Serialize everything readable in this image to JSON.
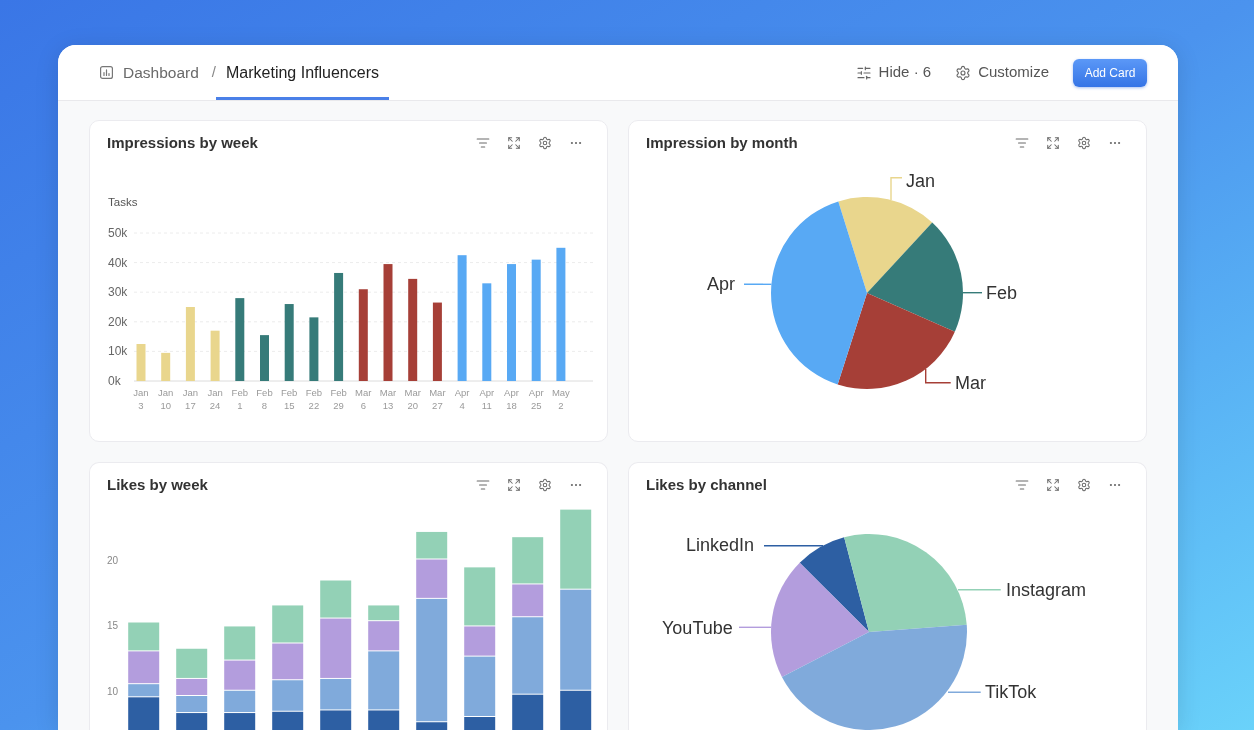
{
  "header": {
    "breadcrumbs": [
      {
        "label": "Dashboard",
        "selected": false
      },
      {
        "label": "Marketing Influencers",
        "selected": true
      }
    ],
    "separator": "/",
    "actions": [
      {
        "kind": "hide",
        "label": "Hide · 6"
      },
      {
        "kind": "customize",
        "label": "Customize"
      }
    ],
    "add_button": "Add Card"
  },
  "cards": [
    {
      "kind": "bar",
      "title": "Impressions by week",
      "chart_data": {
        "type": "bar",
        "ylabel": "Tasks",
        "categories": [
          "Jan 3",
          "Jan 10",
          "Jan 17",
          "Jan 24",
          "Feb 1",
          "Feb 8",
          "Feb 15",
          "Feb 22",
          "Feb 29",
          "Mar 6",
          "Mar 13",
          "Mar 20",
          "Mar 27",
          "Apr 4",
          "Apr 11",
          "Apr 18",
          "Apr 25",
          "May 2"
        ],
        "stacked": true,
        "grid": true,
        "ylim": [
          0,
          50000
        ],
        "yticks": [
          {
            "value": 0,
            "label": "0k"
          },
          {
            "value": 10000,
            "label": "10k"
          },
          {
            "value": 20000,
            "label": "20k"
          },
          {
            "value": 30000,
            "label": "30k"
          },
          {
            "value": 40000,
            "label": "40k"
          },
          {
            "value": 50000,
            "label": "50k"
          }
        ],
        "series": [
          {
            "color": "#e9d68d",
            "values": [
              12500,
              9500,
              25000,
              17000,
              null,
              null,
              null,
              null,
              null,
              null,
              null,
              null,
              null,
              null,
              null,
              null,
              null,
              null
            ]
          },
          {
            "color": "#367b79",
            "values": [
              null,
              null,
              null,
              null,
              28000,
              15500,
              26000,
              21500,
              36500,
              null,
              null,
              null,
              null,
              null,
              null,
              null,
              null,
              null
            ]
          },
          {
            "color": "#a63f37",
            "values": [
              null,
              null,
              null,
              null,
              null,
              null,
              null,
              null,
              null,
              31000,
              39500,
              34500,
              26500,
              null,
              null,
              null,
              null,
              null
            ]
          },
          {
            "color": "#58a9f4",
            "values": [
              null,
              null,
              null,
              null,
              null,
              null,
              null,
              null,
              null,
              null,
              null,
              null,
              null,
              42500,
              33000,
              39500,
              41000,
              45000
            ]
          }
        ]
      }
    },
    {
      "kind": "pie",
      "title": "Impression by month",
      "slices": [
        {
          "label": "Jan",
          "color": "#e9d68d"
        },
        {
          "label": "Feb",
          "color": "#367b79"
        },
        {
          "label": "Mar",
          "color": "#a63f37"
        },
        {
          "label": "Apr",
          "color": "#58a9f4"
        }
      ]
    },
    {
      "kind": "bar",
      "title": "Likes by week",
      "chart_data": {
        "type": "bar",
        "stacked": true,
        "ylim": [
          0,
          24
        ],
        "yticks": [
          10,
          15,
          20
        ],
        "series": [
          {
            "color": "#2d5fa3",
            "values": [
              9.5,
              8.3,
              8.3,
              8.4,
              8.5,
              8.5,
              7.6,
              8.0,
              9.7,
              10.0
            ]
          },
          {
            "color": "#80aadb",
            "values": [
              1.0,
              1.3,
              1.7,
              2.4,
              2.4,
              4.5,
              9.4,
              4.6,
              5.9,
              7.7
            ]
          },
          {
            "color": "#b39ddd",
            "values": [
              2.5,
              1.3,
              2.3,
              2.8,
              4.6,
              2.3,
              3.0,
              2.3,
              2.5,
              0
            ]
          },
          {
            "color": "#93d1b6",
            "values": [
              2.2,
              2.3,
              2.6,
              2.9,
              2.9,
              1.2,
              2.1,
              4.5,
              3.6,
              6.1
            ]
          }
        ]
      }
    },
    {
      "kind": "pie",
      "title": "Likes by channel",
      "slices": [
        {
          "label": "LinkedIn",
          "color": "#2d5fa3"
        },
        {
          "label": "Instagram",
          "color": "#93d1b6"
        },
        {
          "label": "YouTube",
          "color": "#b39ddd"
        },
        {
          "label": "TikTok",
          "color": "#80aadb"
        }
      ]
    }
  ]
}
